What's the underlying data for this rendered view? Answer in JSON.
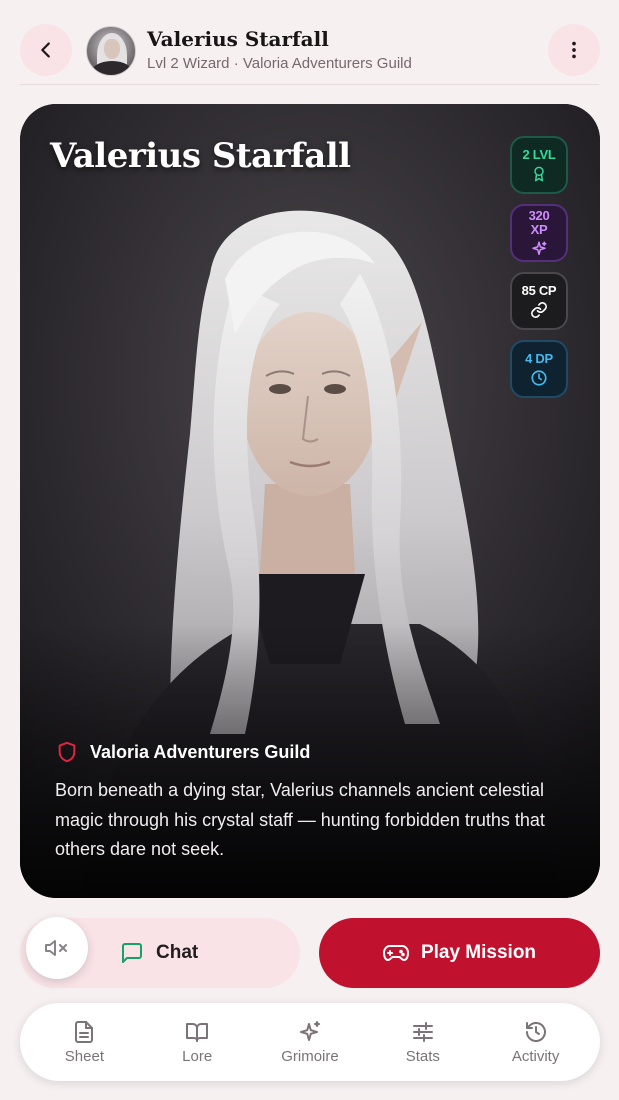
{
  "header": {
    "title": "Valerius Starfall",
    "subtitle": "Lvl 2 Wizard · Valoria Adventurers Guild",
    "back_icon": "chevron-left-icon",
    "more_icon": "more-vertical-icon"
  },
  "card": {
    "title": "Valerius Starfall",
    "badges": [
      {
        "label": "2 LVL",
        "icon": "award-icon",
        "color": "#35d99c"
      },
      {
        "label": "320 XP",
        "icon": "sparkles-icon",
        "color": "#cf8cff"
      },
      {
        "label": "85 CP",
        "icon": "link-icon",
        "color": "#ffffff"
      },
      {
        "label": "4 DP",
        "icon": "clock-icon",
        "color": "#46b8ef"
      }
    ],
    "guild": "Valoria Adventurers Guild",
    "guild_icon": "shield-icon",
    "bio": "Born beneath a dying star, Valerius channels ancient celestial magic through his crystal staff — hunting forbidden truths that others dare not seek."
  },
  "actions": {
    "chat_label": "Chat",
    "chat_icon": "message-square-icon",
    "play_label": "Play Mission",
    "play_icon": "gamepad-icon",
    "mute_icon": "volume-mute-icon"
  },
  "nav": {
    "items": [
      {
        "label": "Sheet",
        "icon": "file-text-icon"
      },
      {
        "label": "Lore",
        "icon": "book-open-icon"
      },
      {
        "label": "Grimoire",
        "icon": "sparkles-icon"
      },
      {
        "label": "Stats",
        "icon": "sliders-icon"
      },
      {
        "label": "Activity",
        "icon": "history-icon"
      }
    ]
  },
  "colors": {
    "accent": "#c0112e",
    "accent_soft": "#f9e3e7",
    "background": "#f6f0f1"
  }
}
